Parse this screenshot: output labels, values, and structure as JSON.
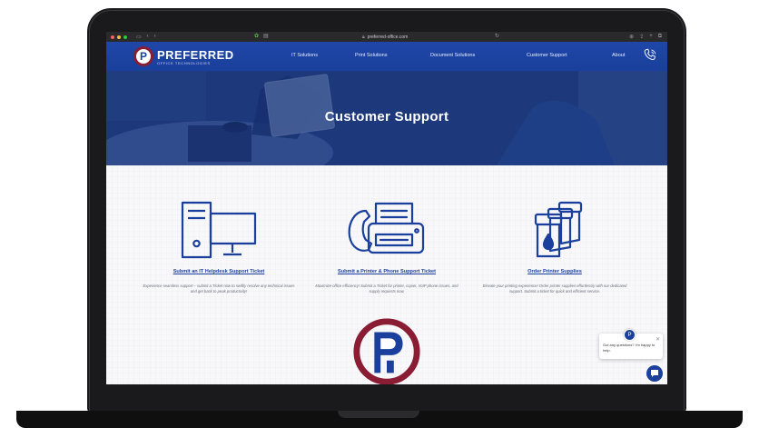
{
  "browser": {
    "url": "preferred-office.com",
    "traffic_lights": [
      "#ff5f57",
      "#febc2e",
      "#28c840"
    ]
  },
  "site": {
    "brand_name": "PREFERRED",
    "brand_sub": "OFFICE TECHNOLOGIES",
    "brand_colors": {
      "blue": "#1a3f9c",
      "maroon": "#8a1c34"
    },
    "nav": [
      "IT Solutions",
      "Print Solutions",
      "Document Solutions",
      "Customer Support",
      "About"
    ]
  },
  "hero": {
    "title": "Customer Support"
  },
  "cards": [
    {
      "icon": "computer-icon",
      "title": "Submit an IT Helpdesk Support Ticket",
      "desc": "Experience seamless support – submit a Ticket now to swiftly resolve any technical issues and get back to peak productivity!"
    },
    {
      "icon": "printer-phone-icon",
      "title": "Submit a Printer & Phone Support Ticket",
      "desc": "Maximize office efficiency! Submit a Ticket for printer, copier, VoIP phone issues, and supply requests now."
    },
    {
      "icon": "printer-supplies-icon",
      "title": "Order Printer Supplies",
      "desc": "Elevate your printing experience! Order printer supplies effortlessly with our dedicated support. Submit a ticket for quick and efficient service."
    }
  ],
  "chat": {
    "message": "Got any questions? I'm happy to help."
  }
}
